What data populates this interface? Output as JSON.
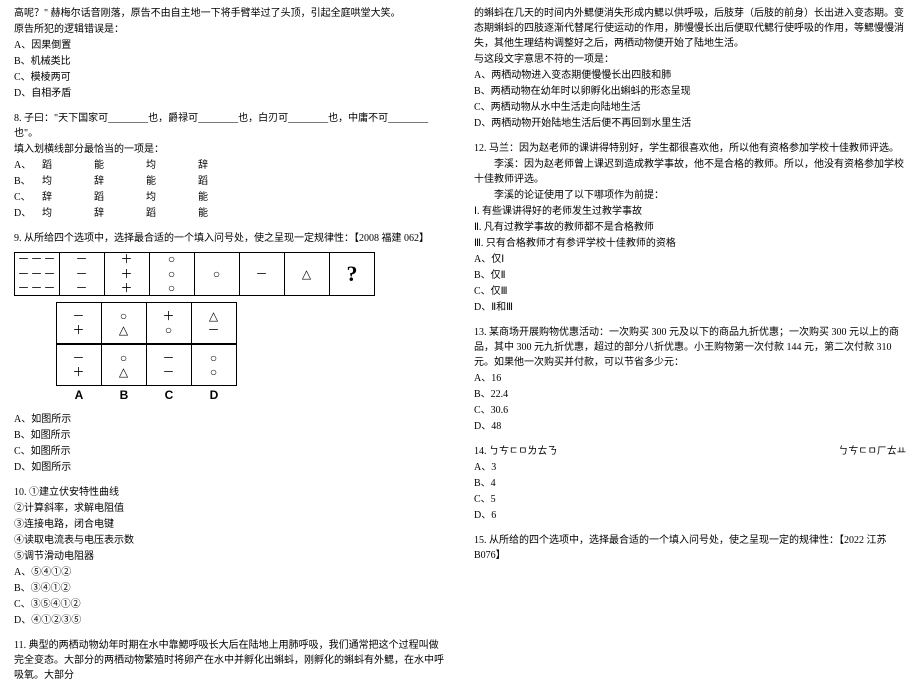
{
  "left": {
    "q7": {
      "intro1": "高呢？\" 赫梅尔话音刚落，原告不由自主地一下将手臂举过了头顶，引起全庭哄堂大笑。",
      "intro2": "原告所犯的逻辑错误是：",
      "opts": [
        "A、因果倒置",
        "B、机械类比",
        "C、模棱两可",
        "D、自相矛盾"
      ]
    },
    "q8": {
      "stem": "8. 子曰：\"天下国家可________也，爵禄可________也，白刃可________也，中庸不可________也\"。",
      "note": "填入划横线部分最恰当的一项是：",
      "rows": [
        [
          "A、",
          "蹈",
          "能",
          "均",
          "辞"
        ],
        [
          "B、",
          "均",
          "辞",
          "能",
          "蹈"
        ],
        [
          "C、",
          "辞",
          "蹈",
          "均",
          "能"
        ],
        [
          "D、",
          "均",
          "辞",
          "蹈",
          "能"
        ]
      ]
    },
    "q9": {
      "stem": "9. 从所给四个选项中，选择最合适的一个填入问号处，使之呈现一定规律性：【2008 福建 062】",
      "row1": [
        [
          "－－－",
          "－－－",
          "－－－"
        ],
        [
          "－",
          "－",
          "－"
        ],
        [
          "＋",
          "＋",
          "＋"
        ],
        [
          "○",
          "○",
          "○"
        ],
        [
          "○",
          " ",
          " "
        ],
        [
          "－",
          " ",
          " "
        ],
        [
          "△",
          " ",
          " "
        ],
        [
          "?"
        ]
      ],
      "row2": [
        [
          "－",
          "＋"
        ],
        [
          "○",
          "△"
        ],
        [
          "＋",
          "○"
        ],
        [
          "△",
          "－"
        ],
        [
          "－",
          "＋"
        ],
        [
          "○",
          "△"
        ],
        [
          "－",
          "－"
        ],
        [
          "○",
          "○"
        ]
      ],
      "row2labels": [
        "A",
        "B",
        "C",
        "D"
      ],
      "opts": [
        "A、如图所示",
        "B、如图所示",
        "C、如图所示",
        "D、如图所示"
      ]
    },
    "q10": {
      "lines": [
        "10. ①建立伏安特性曲线",
        "②计算斜率，求解电阻值",
        "③连接电路，闭合电键",
        "④读取电流表与电压表示数",
        "⑤调节滑动电阻器"
      ],
      "opts": [
        "A、⑤④①②",
        "B、③④①②",
        "C、③⑤④①②",
        "D、④①②③⑤"
      ]
    },
    "q11": {
      "text": "11. 典型的两栖动物幼年时期在水中靠鰓呼吸长大后在陆地上用肺呼吸，我们通常把这个过程叫做完全变态。大部分的两栖动物繁殖时将卵产在水中并孵化出蝌蚪，刚孵化的蝌蚪有外鰓，在水中呼吸氧。大部分"
    }
  },
  "right": {
    "q11c": {
      "p1": "的蝌蚪在几天的时间内外鰓便消失形成内鰓以供呼吸，后肢芽（后肢的前身）长出进入变态期。变态期蝌蚪的四肢逐渐代替尾行使运动的作用，肺慢慢长出后便取代鰓行使呼吸的作用，等鰓慢慢消失，其他生理结构调整好之后，两栖动物便开始了陆地生活。",
      "p2": "与这段文字意思不符的一项是：",
      "opts": [
        "A、两栖动物进入变态期便慢慢长出四肢和肺",
        "B、两栖动物在幼年时以卵孵化出蝌蚪的形态呈现",
        "C、两栖动物从水中生活走向陆地生活",
        "D、两栖动物开始陆地生活后便不再回到水里生活"
      ]
    },
    "q12": {
      "p1": "12. 马兰：因为赵老师的课讲得特别好，学生都很喜欢他，所以他有资格参加学校十佳教师评选。",
      "p2": "　　李溪：因为赵老师曾上课迟到造成教学事故，他不是合格的教师。所以，他没有资格参加学校十佳教师评选。",
      "p3": "　　李溪的论证使用了以下哪项作为前提：",
      "sub": [
        "Ⅰ. 有些课讲得好的老师发生过教学事故",
        "Ⅱ. 凡有过教学事故的教师都不是合格教师",
        "Ⅲ. 只有合格教师才有参评学校十佳教师的资格"
      ],
      "opts": [
        "A、仅Ⅰ",
        "B、仅Ⅱ",
        "C、仅Ⅲ",
        "D、Ⅱ和Ⅲ"
      ]
    },
    "q13": {
      "p1": "13. 某商场开展购物优惠活动：一次购买 300 元及以下的商品九折优惠；一次购买 300 元以上的商品，其中 300 元九折优惠，超过的部分八折优惠。小王购物第一次付款 144 元，第二次付款 310 元。如果他一次购买并付款，可以节省多少元：",
      "opts": [
        "A、16",
        "B、22.4",
        "C、30.6",
        "D、48"
      ]
    },
    "q14": {
      "left": "14. ㄅㄘㄷㅁㄌㄊㄋ",
      "right": "ㄅㄘㄷㅁㄏㄊㅛ",
      "opts": [
        "A、3",
        "B、4",
        "C、5",
        "D、6"
      ]
    },
    "q15": {
      "stem": "15. 从所给的四个选项中，选择最合适的一个填入问号处，使之呈现一定的规律性：【2022 江苏 B076】"
    }
  }
}
